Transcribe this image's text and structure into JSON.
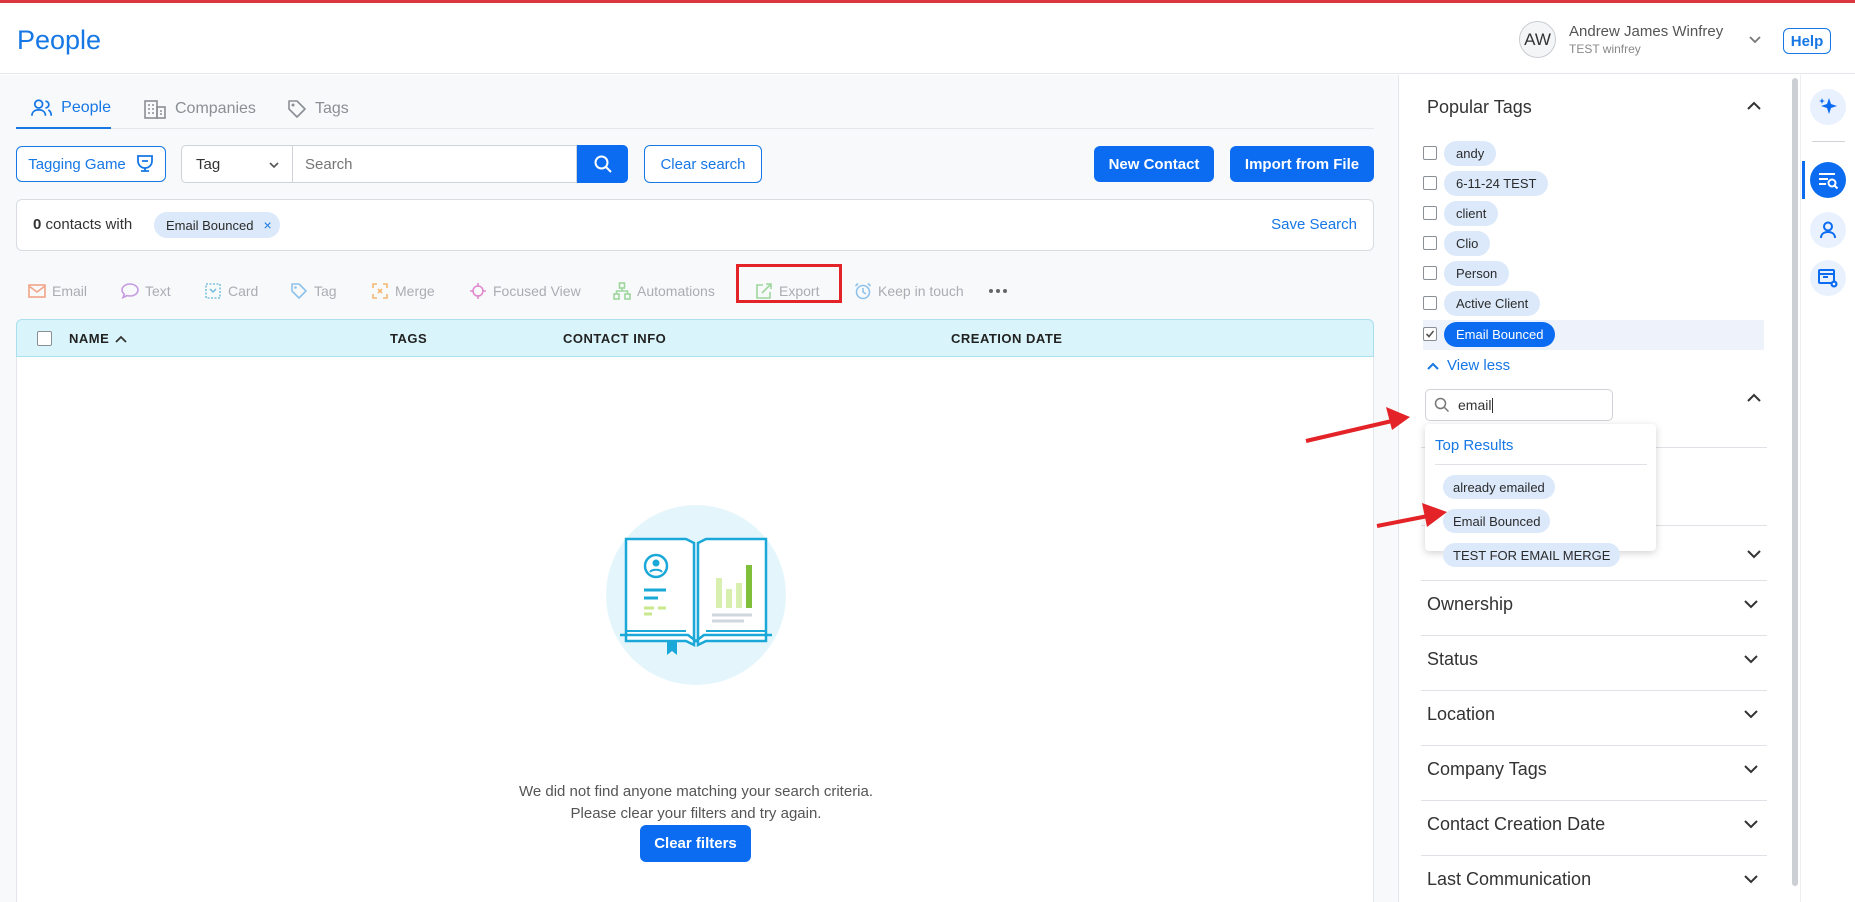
{
  "header": {
    "title": "People",
    "avatar_initials": "AW",
    "user_name": "Andrew James Winfrey",
    "user_org": "TEST winfrey",
    "help_label": "Help"
  },
  "tabs": [
    {
      "label": "People",
      "icon": "people-icon",
      "active": true
    },
    {
      "label": "Companies",
      "icon": "building-icon",
      "active": false
    },
    {
      "label": "Tags",
      "icon": "tag-icon",
      "active": false
    }
  ],
  "toolbar": {
    "tagging_game_label": "Tagging Game",
    "filter_select_value": "Tag",
    "search_placeholder": "Search",
    "clear_search_label": "Clear search",
    "new_contact_label": "New Contact",
    "import_label": "Import from File"
  },
  "filter_bar": {
    "count": "0",
    "count_suffix": "contacts with",
    "active_tag": "Email Bounced",
    "save_search_label": "Save Search"
  },
  "actions": [
    {
      "label": "Email",
      "icon": "mail-icon"
    },
    {
      "label": "Text",
      "icon": "chat-icon"
    },
    {
      "label": "Card",
      "icon": "card-icon"
    },
    {
      "label": "Tag",
      "icon": "tag-icon"
    },
    {
      "label": "Merge",
      "icon": "merge-icon"
    },
    {
      "label": "Focused View",
      "icon": "focus-icon"
    },
    {
      "label": "Automations",
      "icon": "automation-icon"
    },
    {
      "label": "Export",
      "icon": "export-icon"
    },
    {
      "label": "Keep in touch",
      "icon": "alarm-icon"
    }
  ],
  "table": {
    "columns": [
      "NAME",
      "TAGS",
      "CONTACT INFO",
      "CREATION DATE"
    ],
    "empty_line1": "We did not find anyone matching your search criteria.",
    "empty_line2": "Please clear your filters and try again.",
    "clear_filters_label": "Clear filters"
  },
  "sidebar": {
    "popular_tags_title": "Popular Tags",
    "tags": [
      {
        "label": "andy",
        "checked": false
      },
      {
        "label": "6-11-24 TEST",
        "checked": false
      },
      {
        "label": "client",
        "checked": false
      },
      {
        "label": "Clio",
        "checked": false
      },
      {
        "label": "Person",
        "checked": false
      },
      {
        "label": "Active Client",
        "checked": false
      },
      {
        "label": "Email Bounced",
        "checked": true
      }
    ],
    "view_less_label": "View less",
    "tag_search_value": "email",
    "dropdown": {
      "title": "Top Results",
      "items": [
        "already emailed",
        "Email Bounced",
        "TEST FOR EMAIL MERGE"
      ]
    },
    "sections": [
      "Ownership",
      "Status",
      "Location",
      "Company Tags",
      "Contact Creation Date",
      "Last Communication"
    ]
  },
  "colors": {
    "accent": "#0b6cf2",
    "link": "#1677e5",
    "annotation": "#e32327",
    "table_header": "#d9f5fb"
  }
}
